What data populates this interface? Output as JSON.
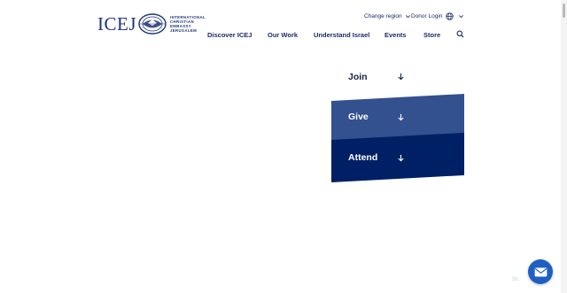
{
  "logo": {
    "wordmark": "ICEJ",
    "tagline": [
      "INTERNATIONAL",
      "CHRISTIAN",
      "EMBASSY",
      "JERUSALEM"
    ],
    "icon": "globe-dove-emblem"
  },
  "utility": {
    "region_label": "Change region",
    "donor_login": "Donor Login",
    "language_icon": "globe-icon"
  },
  "nav": {
    "items": [
      "Discover ICEJ",
      "Our Work",
      "Understand Israel",
      "Events",
      "Store"
    ],
    "search_icon": "search-icon"
  },
  "panels": {
    "join": "Join",
    "give": "Give",
    "attend": "Attend"
  },
  "colors": {
    "brand_navy": "#1d2b63",
    "give_bg": "#33508f",
    "attend_bg": "#002066",
    "chat_blue": "#1f5fc4"
  },
  "widget": {
    "watermark": "Sc",
    "chat_icon": "envelope-icon"
  }
}
